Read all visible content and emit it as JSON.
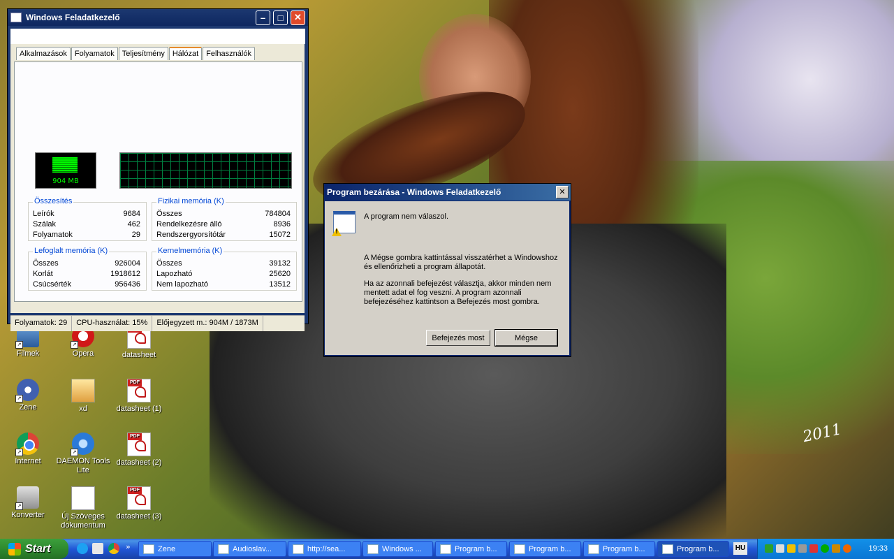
{
  "desktop": {
    "icons": [
      {
        "label": "Filmek",
        "icon": "film-icon"
      },
      {
        "label": "Opera",
        "icon": "opera-icon"
      },
      {
        "label": "datasheet",
        "icon": "pdf-icon"
      },
      {
        "label": "Zene",
        "icon": "music-icon"
      },
      {
        "label": "xd",
        "icon": "image-icon"
      },
      {
        "label": "datasheet (1)",
        "icon": "pdf-icon"
      },
      {
        "label": "Internet",
        "icon": "chrome-icon"
      },
      {
        "label": "DAEMON Tools Lite",
        "icon": "daemon-tools-icon"
      },
      {
        "label": "datasheet (2)",
        "icon": "pdf-icon"
      },
      {
        "label": "Konverter",
        "icon": "converter-icon"
      },
      {
        "label": "Új Szöveges dokumentum",
        "icon": "text-document-icon"
      },
      {
        "label": "datasheet (3)",
        "icon": "pdf-icon"
      }
    ],
    "signature": "2011"
  },
  "taskmanager": {
    "title": "Windows Feladatkezelő",
    "tabs": [
      "Alkalmazások",
      "Folyamatok",
      "Teljesítmény",
      "Hálózat",
      "Felhasználók"
    ],
    "active_tab": "Hálózat",
    "meter_label": "904 MB",
    "groups": {
      "totals": {
        "title": "Összesítés",
        "rows": [
          {
            "label": "Leírók",
            "value": "9684"
          },
          {
            "label": "Szálak",
            "value": "462"
          },
          {
            "label": "Folyamatok",
            "value": "29"
          }
        ]
      },
      "physical": {
        "title": "Fizikai memória (K)",
        "rows": [
          {
            "label": "Összes",
            "value": "784804"
          },
          {
            "label": "Rendelkezésre álló",
            "value": "8936"
          },
          {
            "label": "Rendszergyorsítótár",
            "value": "15072"
          }
        ]
      },
      "commit": {
        "title": "Lefoglalt memória (K)",
        "rows": [
          {
            "label": "Összes",
            "value": "926004"
          },
          {
            "label": "Korlát",
            "value": "1918612"
          },
          {
            "label": "Csúcsérték",
            "value": "956436"
          }
        ]
      },
      "kernel": {
        "title": "Kernelmemória (K)",
        "rows": [
          {
            "label": "Összes",
            "value": "39132"
          },
          {
            "label": "Lapozható",
            "value": "25620"
          },
          {
            "label": "Nem lapozható",
            "value": "13512"
          }
        ]
      }
    },
    "status": {
      "processes": "Folyamatok: 29",
      "cpu": "CPU-használat: 15%",
      "commit": "Előjegyzett m.: 904M / 1873M"
    }
  },
  "dialog": {
    "title": "Program bezárása - Windows Feladatkezelő",
    "message": "A program nem válaszol.",
    "para1": "A Mégse gombra kattintással visszatérhet a Windowshoz és ellenőrizheti a program  állapotát.",
    "para2": "Ha az azonnali befejezést választja, akkor minden nem mentett adat el fog veszni. A program azonnali befejezéséhez kattintson a Befejezés most gombra.",
    "end_now": "Befejezés most",
    "cancel": "Mégse"
  },
  "taskbar": {
    "start": "Start",
    "tasks": [
      {
        "label": "Zene"
      },
      {
        "label": "Audioslav..."
      },
      {
        "label": "http://sea..."
      },
      {
        "label": "Windows ..."
      },
      {
        "label": "Program b..."
      },
      {
        "label": "Program b..."
      },
      {
        "label": "Program b..."
      },
      {
        "label": "Program b..."
      }
    ],
    "lang": "HU",
    "clock": "19:33"
  }
}
